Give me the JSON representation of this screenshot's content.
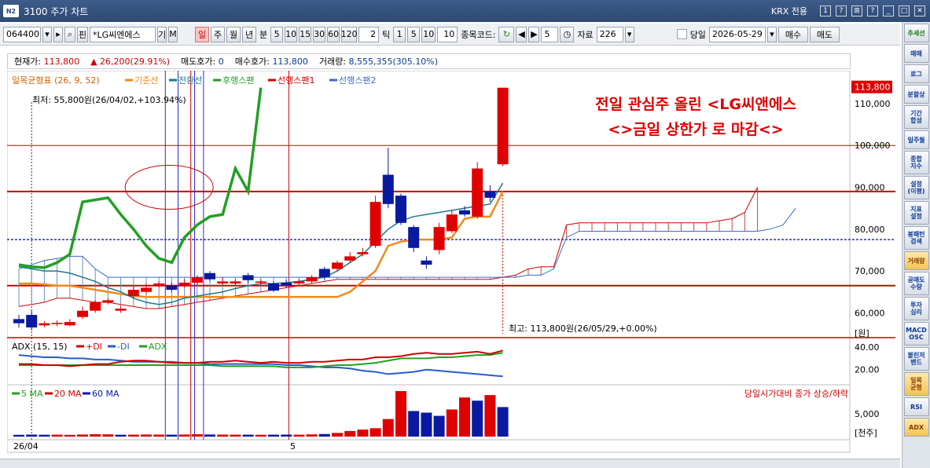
{
  "window": {
    "code_badge": "N2",
    "title": "3100 주가 차트",
    "krx_label": "KRX 전용",
    "btns": [
      "1",
      "?",
      "⊞",
      "?",
      "_",
      "□",
      "✕"
    ]
  },
  "toolbar": {
    "stock_code": "064400",
    "stock_name": "*LG씨엔에스",
    "flag1": "기",
    "flag2": "M",
    "periods": [
      "일",
      "주",
      "월",
      "년",
      "분"
    ],
    "active_period": "일",
    "minutes": [
      "5",
      "10",
      "15",
      "30",
      "60",
      "120"
    ],
    "tick_value": "2",
    "tick_label": "틱",
    "counts": [
      "1",
      "5",
      "10"
    ],
    "count_value": "10",
    "stock_code_label": "종목코드:",
    "page_value": "5",
    "data_label": "자료",
    "data_count": "226",
    "same_day_label": "당일",
    "date_value": "2026-05-29",
    "buy_label": "매수",
    "sell_label": "매도"
  },
  "info": {
    "price_label": "현재가:",
    "price": "113,800",
    "change": "26,200(29.91%)",
    "ask_label": "매도호가:",
    "ask": "0",
    "bid_label": "매수호가:",
    "bid": "113,800",
    "volume_label": "거래량:",
    "volume": "8,555,355(305.10%)"
  },
  "legend": {
    "ichimoku": "일목균형표 (26, 9, 52)",
    "base": "기준선",
    "conv": "전환선",
    "lag": "후행스팬",
    "lead1": "선행스팬1",
    "lead2": "선행스팬2",
    "adx_title": "ADX (15, 15)",
    "pdi": "+DI",
    "mdi": "-DI",
    "adx": "ADX",
    "vol_ma5": "5 MA",
    "vol_ma20": "20 MA",
    "vol_ma60": "60 MA",
    "vol_note": "당일시가대비 종가 상승/하락"
  },
  "annotation": {
    "line1": "전일 관심주 올린 <LG씨앤에스",
    "line2": "<>금일 상한가 로 마감<>"
  },
  "labels": {
    "low": "최저: 55,800원(26/04/02,+103.94%)",
    "high": "최고: 113,800원(26/05/29,+0.00%)",
    "current_tag": "113,800",
    "price_ticks": [
      "110,000",
      "100,000",
      "90,000",
      "80,000",
      "70,000",
      "60,000"
    ],
    "price_unit": "[원]",
    "adx_ticks": [
      "40.00",
      "20.00"
    ],
    "vol_tick": "5,000",
    "vol_unit": "[천주]",
    "date_ticks": [
      "26/04",
      "5"
    ]
  },
  "chart_data": {
    "type": "candlestick",
    "price_range": [
      55000,
      116000
    ],
    "candles": [
      {
        "o": 58500,
        "c": 57500,
        "h": 59500,
        "l": 56500
      },
      {
        "o": 59500,
        "c": 56500,
        "h": 60500,
        "l": 55800
      },
      {
        "o": 57000,
        "c": 57500,
        "h": 58000,
        "l": 56500
      },
      {
        "o": 57300,
        "c": 57600,
        "h": 58200,
        "l": 56800
      },
      {
        "o": 57000,
        "c": 57800,
        "h": 58500,
        "l": 56800
      },
      {
        "o": 59000,
        "c": 60500,
        "h": 61500,
        "l": 58500
      },
      {
        "o": 60500,
        "c": 62500,
        "h": 63000,
        "l": 60000
      },
      {
        "o": 62500,
        "c": 63000,
        "h": 63500,
        "l": 62000
      },
      {
        "o": 60500,
        "c": 61000,
        "h": 61800,
        "l": 60000
      },
      {
        "o": 64000,
        "c": 65500,
        "h": 66500,
        "l": 63500
      },
      {
        "o": 65000,
        "c": 66000,
        "h": 67000,
        "l": 64500
      },
      {
        "o": 66500,
        "c": 67000,
        "h": 67500,
        "l": 66000
      },
      {
        "o": 66500,
        "c": 65500,
        "h": 67200,
        "l": 65000
      },
      {
        "o": 66500,
        "c": 67200,
        "h": 68000,
        "l": 66000
      },
      {
        "o": 67200,
        "c": 68500,
        "h": 69000,
        "l": 66500
      },
      {
        "o": 69500,
        "c": 68000,
        "h": 70000,
        "l": 67500
      },
      {
        "o": 67000,
        "c": 67500,
        "h": 68500,
        "l": 66500
      },
      {
        "o": 67000,
        "c": 67500,
        "h": 68000,
        "l": 66500
      },
      {
        "o": 69000,
        "c": 67800,
        "h": 69500,
        "l": 67000
      },
      {
        "o": 67200,
        "c": 67500,
        "h": 68000,
        "l": 66500
      },
      {
        "o": 67000,
        "c": 65300,
        "h": 67500,
        "l": 65000
      },
      {
        "o": 67200,
        "c": 66500,
        "h": 67800,
        "l": 66000
      },
      {
        "o": 67000,
        "c": 67500,
        "h": 68000,
        "l": 66500
      },
      {
        "o": 67500,
        "c": 68500,
        "h": 69000,
        "l": 67000
      },
      {
        "o": 70500,
        "c": 68500,
        "h": 71000,
        "l": 68000
      },
      {
        "o": 70500,
        "c": 72000,
        "h": 72500,
        "l": 70000
      },
      {
        "o": 72500,
        "c": 73500,
        "h": 74500,
        "l": 72000
      },
      {
        "o": 74000,
        "c": 74500,
        "h": 75500,
        "l": 73500
      },
      {
        "o": 76000,
        "c": 86500,
        "h": 88000,
        "l": 75500
      },
      {
        "o": 93000,
        "c": 86000,
        "h": 99500,
        "l": 85000
      },
      {
        "o": 88000,
        "c": 81500,
        "h": 88500,
        "l": 81000
      },
      {
        "o": 80500,
        "c": 75500,
        "h": 81000,
        "l": 74500
      },
      {
        "o": 72500,
        "c": 71500,
        "h": 73500,
        "l": 70500
      },
      {
        "o": 75000,
        "c": 80500,
        "h": 81500,
        "l": 74000
      },
      {
        "o": 79500,
        "c": 83500,
        "h": 84500,
        "l": 79000
      },
      {
        "o": 84500,
        "c": 83500,
        "h": 85500,
        "l": 83000
      },
      {
        "o": 83000,
        "c": 94500,
        "h": 96000,
        "l": 82500
      },
      {
        "o": 89000,
        "c": 87500,
        "h": 90500,
        "l": 86500
      },
      {
        "o": 95500,
        "c": 113800,
        "h": 113800,
        "l": 95000
      }
    ],
    "base_line": [
      67000,
      67000,
      66800,
      66500,
      66500,
      66000,
      65500,
      65000,
      64500,
      64000,
      63800,
      63800,
      63800,
      63800,
      63800,
      63800,
      63800,
      63800,
      63800,
      63800,
      63800,
      63800,
      63800,
      63800,
      63800,
      63800,
      65000,
      67500,
      70000,
      76000,
      77000,
      77500,
      77500,
      77500,
      78000,
      82500,
      83000,
      83000,
      89000
    ],
    "conv_line": [
      71000,
      70500,
      70000,
      70000,
      69500,
      68500,
      67500,
      66000,
      65000,
      63500,
      62500,
      62000,
      62500,
      63500,
      64000,
      64500,
      65000,
      65800,
      66500,
      67000,
      67000,
      67200,
      67500,
      68000,
      68500,
      70000,
      72000,
      74000,
      77000,
      80000,
      82000,
      83000,
      83500,
      84000,
      84500,
      85000,
      85500,
      86000,
      91000
    ],
    "lag_line": [
      71500,
      71000,
      70800,
      72000,
      74000,
      86500,
      87000,
      87500,
      83500,
      80000,
      76000,
      73000,
      72000,
      78000,
      81000,
      83000,
      83500,
      94500,
      89000,
      113800
    ],
    "lead1": [
      61500,
      62000,
      62500,
      63500,
      63500,
      63000,
      62500,
      62500,
      62000,
      61500,
      61000,
      61000,
      61500,
      62000,
      62500,
      63000,
      63500,
      64000,
      64500,
      65000,
      65500,
      66000,
      66500,
      67000,
      67500,
      68000,
      68000,
      68000,
      68000,
      68000,
      68000,
      68000,
      68000,
      68000,
      68000,
      68000,
      68000,
      68000,
      68500,
      69000,
      70500,
      71000,
      71000,
      81000,
      81500,
      81500,
      81500,
      81500,
      81500,
      81500,
      81500,
      81500,
      81500,
      81500,
      81500,
      82000,
      82500,
      84000,
      90000
    ],
    "lead2": [
      70500,
      71500,
      72500,
      73000,
      73500,
      73500,
      70500,
      68500,
      68500,
      68500,
      68500,
      68500,
      68500,
      68500,
      68500,
      68500,
      68500,
      68500,
      68500,
      68500,
      68500,
      68500,
      68500,
      68500,
      68500,
      68500,
      68500,
      68500,
      68500,
      68500,
      68500,
      68500,
      68500,
      68500,
      68500,
      68500,
      68500,
      68500,
      68500,
      68500,
      69000,
      69000,
      70500,
      78000,
      79500,
      79500,
      79500,
      79500,
      79500,
      79500,
      79500,
      79500,
      79500,
      79500,
      79500,
      79500,
      79500,
      79500,
      79500,
      80000,
      81000,
      85000
    ],
    "adx": {
      "pdi": [
        25,
        25,
        24,
        24,
        23,
        24,
        25,
        25,
        27,
        28,
        28,
        27,
        26,
        26,
        26,
        27,
        27,
        28,
        27,
        26,
        27,
        26,
        26,
        27,
        27,
        28,
        29,
        29,
        31,
        31,
        32,
        34,
        35,
        34,
        34,
        35,
        36,
        34,
        37
      ],
      "mdi": [
        33,
        32,
        31,
        31,
        30,
        30,
        29,
        29,
        28,
        27,
        27,
        27,
        27,
        26,
        26,
        25,
        25,
        25,
        25,
        25,
        25,
        24,
        24,
        23,
        22,
        22,
        21,
        19,
        18,
        16,
        17,
        18,
        20,
        19,
        18,
        17,
        16,
        15,
        14
      ],
      "adx_line": [
        24,
        24,
        24,
        24,
        24,
        24,
        24,
        24,
        24,
        24,
        24,
        24,
        24,
        24,
        24,
        24,
        23,
        23,
        23,
        23,
        23,
        22,
        22,
        22,
        23,
        24,
        24,
        25,
        26,
        28,
        30,
        30,
        30,
        31,
        31,
        32,
        33,
        33,
        35
      ]
    },
    "volume": {
      "values": [
        220,
        250,
        230,
        240,
        220,
        260,
        300,
        280,
        230,
        240,
        260,
        250,
        240,
        260,
        300,
        260,
        250,
        240,
        240,
        230,
        240,
        250,
        240,
        280,
        320,
        460,
        700,
        880,
        1050,
        2200,
        5700,
        3200,
        3000,
        2600,
        3400,
        4900,
        4500,
        5200,
        3700
      ],
      "up": [
        false,
        false,
        false,
        true,
        true,
        true,
        true,
        true,
        false,
        true,
        true,
        true,
        false,
        true,
        true,
        false,
        true,
        true,
        false,
        true,
        false,
        false,
        true,
        true,
        false,
        true,
        true,
        true,
        true,
        true,
        true,
        false,
        false,
        false,
        true,
        true,
        false,
        true,
        false
      ]
    }
  }
}
